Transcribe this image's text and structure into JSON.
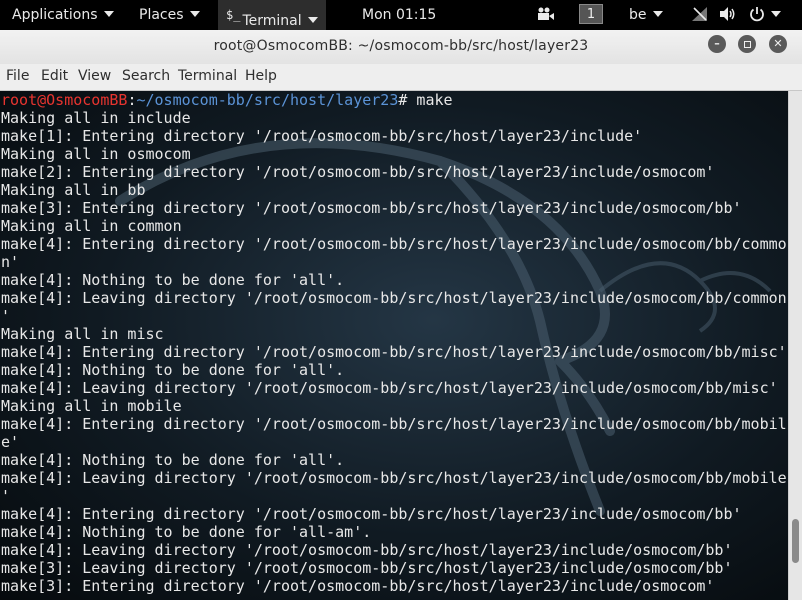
{
  "panel": {
    "applications": "Applications",
    "places": "Places",
    "terminal_icon": "$_",
    "terminal": "Terminal",
    "clock": "Mon 01:15",
    "workspace": "1",
    "keyboard_layout": "be"
  },
  "window": {
    "title": "root@OsmocomBB: ~/osmocom-bb/src/host/layer23"
  },
  "menu": {
    "items": [
      "File",
      "Edit",
      "View",
      "Search",
      "Terminal",
      "Help"
    ]
  },
  "terminal": {
    "prompt_user": "root@OsmocomBB",
    "prompt_sep": ":",
    "prompt_path": "~/osmocom-bb/src/host/layer23",
    "prompt_end": "# make",
    "lines": [
      "Making all in include",
      "make[1]: Entering directory '/root/osmocom-bb/src/host/layer23/include'",
      "Making all in osmocom",
      "make[2]: Entering directory '/root/osmocom-bb/src/host/layer23/include/osmocom'",
      "Making all in bb",
      "make[3]: Entering directory '/root/osmocom-bb/src/host/layer23/include/osmocom/bb'",
      "Making all in common",
      "make[4]: Entering directory '/root/osmocom-bb/src/host/layer23/include/osmocom/bb/commo",
      "n'",
      "make[4]: Nothing to be done for 'all'.",
      "make[4]: Leaving directory '/root/osmocom-bb/src/host/layer23/include/osmocom/bb/common",
      "'",
      "Making all in misc",
      "make[4]: Entering directory '/root/osmocom-bb/src/host/layer23/include/osmocom/bb/misc'",
      "make[4]: Nothing to be done for 'all'.",
      "make[4]: Leaving directory '/root/osmocom-bb/src/host/layer23/include/osmocom/bb/misc'",
      "Making all in mobile",
      "make[4]: Entering directory '/root/osmocom-bb/src/host/layer23/include/osmocom/bb/mobil",
      "e'",
      "make[4]: Nothing to be done for 'all'.",
      "make[4]: Leaving directory '/root/osmocom-bb/src/host/layer23/include/osmocom/bb/mobile",
      "'",
      "make[4]: Entering directory '/root/osmocom-bb/src/host/layer23/include/osmocom/bb'",
      "make[4]: Nothing to be done for 'all-am'.",
      "make[4]: Leaving directory '/root/osmocom-bb/src/host/layer23/include/osmocom/bb'",
      "make[3]: Leaving directory '/root/osmocom-bb/src/host/layer23/include/osmocom/bb'",
      "make[3]: Entering directory '/root/osmocom-bb/src/host/layer23/include/osmocom'"
    ]
  }
}
